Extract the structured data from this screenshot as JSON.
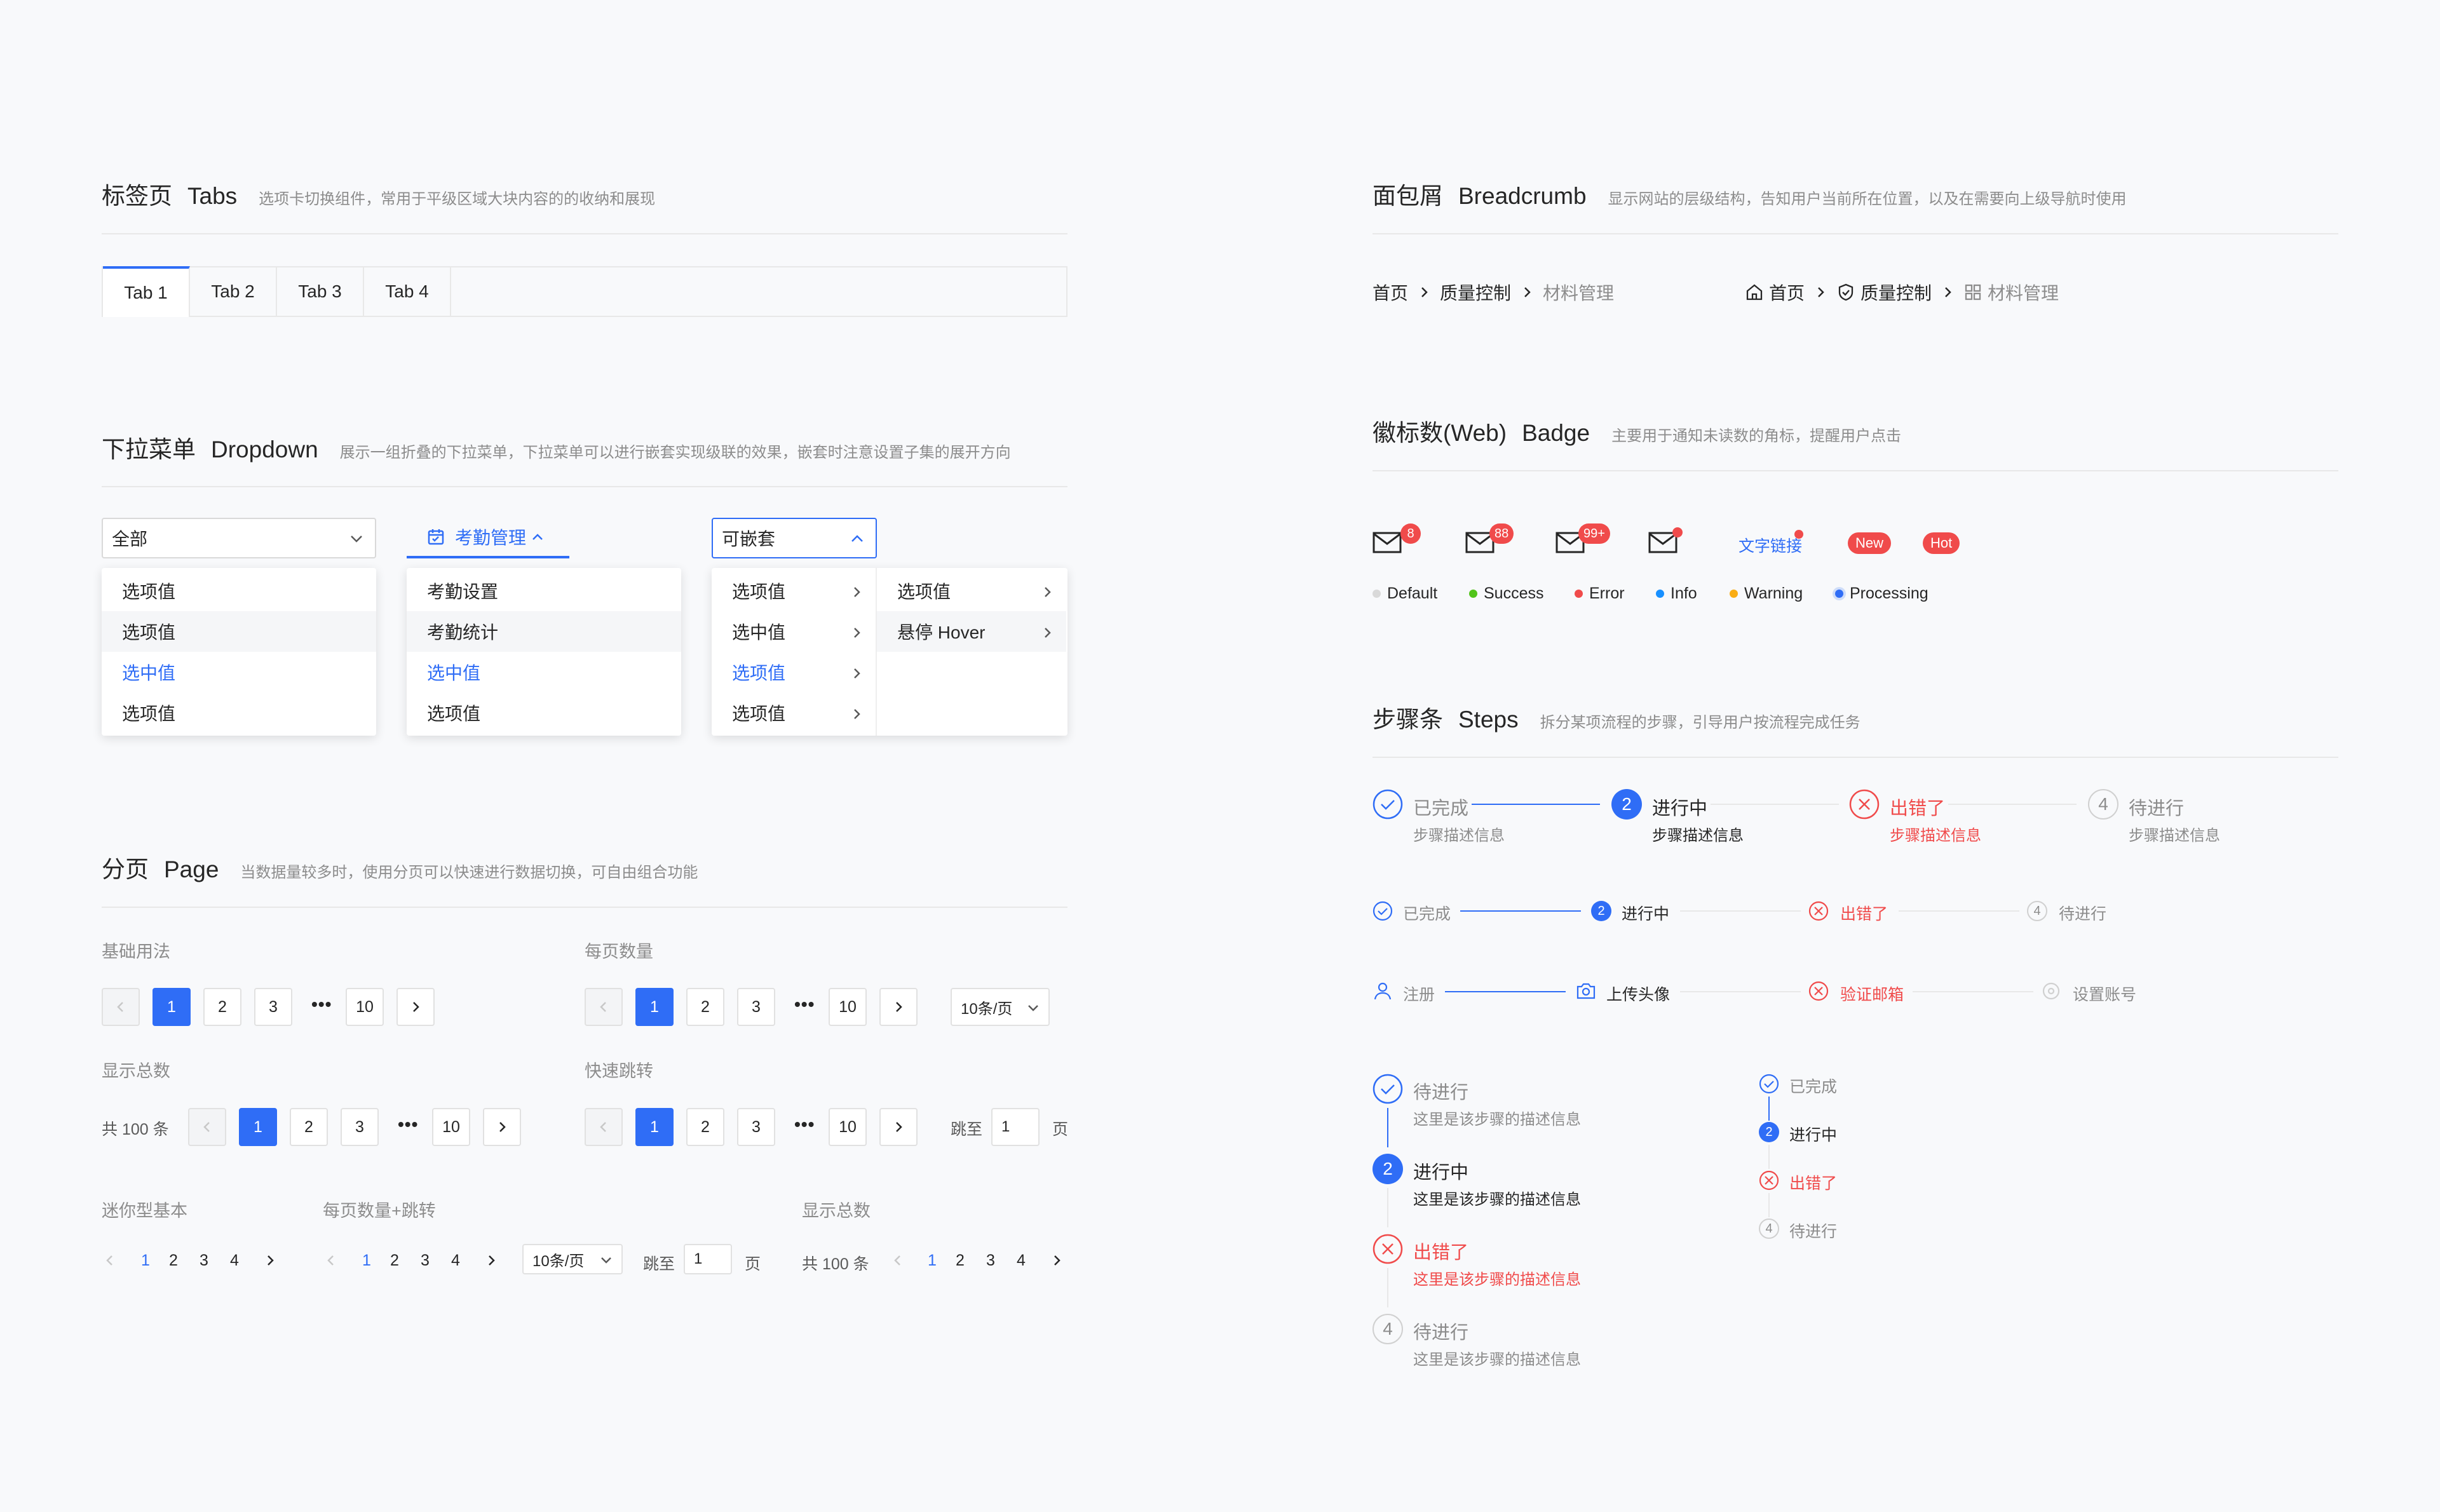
{
  "tabs_section": {
    "title": "标签页",
    "title_en": "Tabs",
    "desc": "选项卡切换组件，常用于平级区域大块内容的的收纳和展现",
    "tabs": [
      "Tab 1",
      "Tab 2",
      "Tab 3",
      "Tab 4"
    ]
  },
  "dropdown_section": {
    "title": "下拉菜单",
    "title_en": "Dropdown",
    "desc": "展示一组折叠的下拉菜单，下拉菜单可以进行嵌套实现级联的效果，嵌套时注意设置子集的展开方向",
    "d1": {
      "value": "全部",
      "items": [
        "选项值",
        "选项值",
        "选中值",
        "选项值"
      ]
    },
    "d2": {
      "value": "考勤管理",
      "items": [
        "考勤设置",
        "考勤统计",
        "选中值",
        "选项值"
      ]
    },
    "d3": {
      "value": "可嵌套",
      "items": [
        "选项值",
        "选中值",
        "选项值",
        "选项值"
      ],
      "sub_items": [
        "选项值",
        "悬停 Hover"
      ]
    }
  },
  "page_section": {
    "title": "分页",
    "title_en": "Page",
    "desc": "当数据量较多时，使用分页可以快速进行数据切换，可自由组合功能",
    "labels": {
      "basic": "基础用法",
      "per_page": "每页数量",
      "total": "显示总数",
      "jump": "快速跳转",
      "mini_basic": "迷你型基本",
      "mini_per_jump": "每页数量+跳转",
      "mini_total": "显示总数"
    },
    "pages": [
      "1",
      "2",
      "3",
      "10"
    ],
    "mini_pages": [
      "1",
      "2",
      "3",
      "4"
    ],
    "per_page_value": "10条/页",
    "total_text": "共 100 条",
    "jump_to": "跳至",
    "jump_value": "1",
    "page_unit": "页"
  },
  "breadcrumb_section": {
    "title": "面包屑",
    "title_en": "Breadcrumb",
    "desc": "显示网站的层级结构，告知用户当前所在位置，以及在需要向上级导航时使用",
    "items": [
      "首页",
      "质量控制",
      "材料管理"
    ]
  },
  "badge_section": {
    "title": "徽标数(Web)",
    "title_en": "Badge",
    "desc": "主要用于通知未读数的角标，提醒用户点击",
    "counts": [
      "8",
      "88",
      "99+"
    ],
    "link_text": "文字链接",
    "new_tag": "New",
    "hot_tag": "Hot",
    "statuses": [
      {
        "label": "Default",
        "color": "#d9d9d9"
      },
      {
        "label": "Success",
        "color": "#52c41a"
      },
      {
        "label": "Error",
        "color": "#f04b4b"
      },
      {
        "label": "Info",
        "color": "#1890ff"
      },
      {
        "label": "Warning",
        "color": "#faad14"
      },
      {
        "label": "Processing",
        "color": "#2f6df6"
      }
    ]
  },
  "steps_section": {
    "title": "步骤条",
    "title_en": "Steps",
    "desc": "拆分某项流程的步骤，引导用户按流程完成任务",
    "steps": [
      {
        "title": "已完成",
        "desc": "步骤描述信息",
        "num": ""
      },
      {
        "title": "进行中",
        "desc": "步骤描述信息",
        "num": "2"
      },
      {
        "title": "出错了",
        "desc": "步骤描述信息",
        "num": ""
      },
      {
        "title": "待进行",
        "desc": "步骤描述信息",
        "num": "4"
      }
    ],
    "icon_steps": [
      "注册",
      "上传头像",
      "验证邮箱",
      "设置账号"
    ],
    "vertical_desc": "这里是该步骤的描述信息"
  },
  "colors": {
    "primary": "#2f6df6",
    "error": "#f04b4b",
    "border": "#e8e8e8"
  }
}
